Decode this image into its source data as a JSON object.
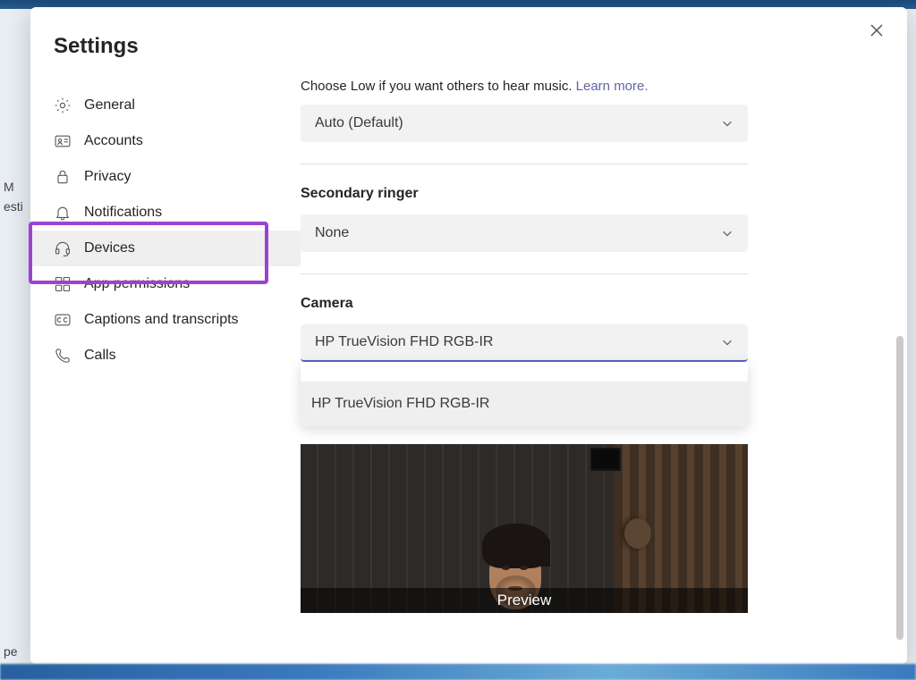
{
  "title": "Settings",
  "background": {
    "left1": "M",
    "left2": "esti",
    "left3": "pe"
  },
  "sidebar": {
    "items": [
      {
        "label": "General"
      },
      {
        "label": "Accounts"
      },
      {
        "label": "Privacy"
      },
      {
        "label": "Notifications"
      },
      {
        "label": "Devices"
      },
      {
        "label": "App permissions"
      },
      {
        "label": "Captions and transcripts"
      },
      {
        "label": "Calls"
      }
    ]
  },
  "content": {
    "noise_hint_prefix": "Choose Low if you want others to hear music. ",
    "learn_more": "Learn more.",
    "noise_select": "Auto (Default)",
    "secondary_ringer_label": "Secondary ringer",
    "secondary_ringer_value": "None",
    "camera_label": "Camera",
    "camera_value": "HP TrueVision FHD RGB-IR",
    "camera_option": "HP TrueVision FHD RGB-IR",
    "preview_label": "Preview"
  }
}
